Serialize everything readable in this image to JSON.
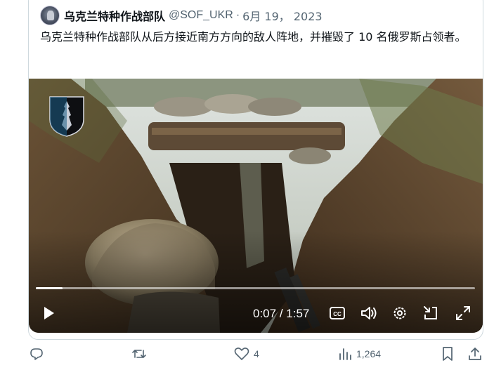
{
  "tweet": {
    "author_name": "乌克兰特种作战部队",
    "handle": "@SOF_UKR",
    "separator": "·",
    "date": "6月 19， 2023",
    "text": "乌克兰特种作战部队从后方接近南方方向的敌人阵地，并摧毁了 10 名俄罗斯占领者。"
  },
  "video": {
    "current_time": "0:07",
    "separator": " / ",
    "duration": "1:57",
    "progress_fraction": 0.06,
    "cc_label": "CC",
    "icons": [
      "play-icon",
      "captions-icon",
      "volume-icon",
      "settings-icon",
      "picture-in-picture-icon",
      "fullscreen-icon"
    ]
  },
  "actions": {
    "replies": "",
    "retweets": "",
    "likes": "4",
    "views": "1,264"
  },
  "colors": {
    "text_primary": "#0f1419",
    "text_secondary": "#536471",
    "border": "#cfd9de"
  }
}
